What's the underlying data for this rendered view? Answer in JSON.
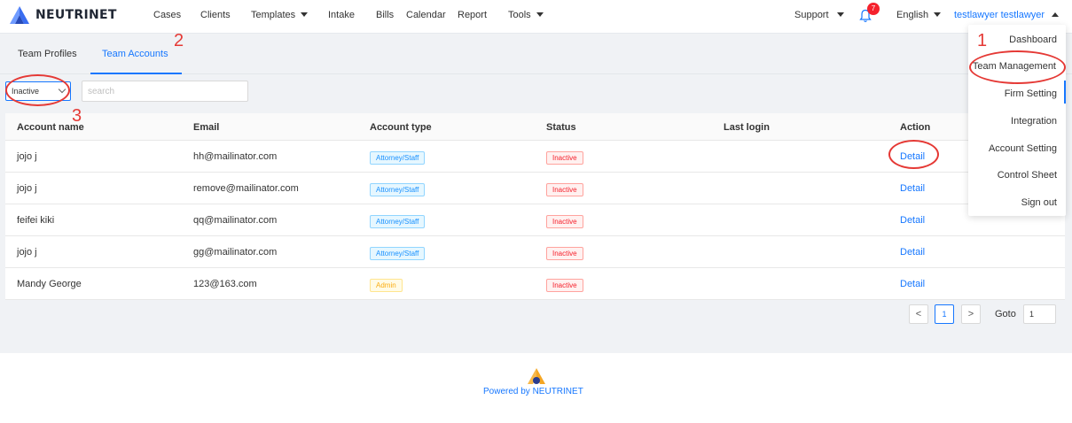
{
  "nav": {
    "brand": "NEUTRINET",
    "items": [
      "Cases",
      "Clients",
      "Templates",
      "Intake",
      "Bills",
      "Calendar",
      "Report",
      "Tools"
    ],
    "support": "Support",
    "notification_count": "7",
    "language": "English",
    "user": "testlawyer testlawyer"
  },
  "tabs": [
    "Team Profiles",
    "Team Accounts"
  ],
  "active_tab": "Team Accounts",
  "filter": {
    "selected": "Inactive"
  },
  "search": {
    "placeholder": "search",
    "value": ""
  },
  "table": {
    "headers": [
      "Account name",
      "Email",
      "Account type",
      "Status",
      "Last login",
      "Action"
    ],
    "rows": [
      {
        "name": "jojo j",
        "email": "hh@mailinator.com",
        "type": "Attorney/Staff",
        "status": "Inactive",
        "last_login": "",
        "action": "Detail"
      },
      {
        "name": "jojo j",
        "email": "remove@mailinator.com",
        "type": "Attorney/Staff",
        "status": "Inactive",
        "last_login": "",
        "action": "Detail"
      },
      {
        "name": "feifei kiki",
        "email": "qq@mailinator.com",
        "type": "Attorney/Staff",
        "status": "Inactive",
        "last_login": "",
        "action": "Detail"
      },
      {
        "name": "jojo j",
        "email": "gg@mailinator.com",
        "type": "Attorney/Staff",
        "status": "Inactive",
        "last_login": "",
        "action": "Detail"
      },
      {
        "name": "Mandy George",
        "email": "123@163.com",
        "type": "Admin",
        "status": "Inactive",
        "last_login": "",
        "action": "Detail"
      }
    ]
  },
  "pagination": {
    "prev": "<",
    "current": "1",
    "next": ">",
    "goto_label": "Goto",
    "goto_value": "1"
  },
  "user_menu": [
    "Dashboard",
    "Team Management",
    "Firm Setting",
    "Integration",
    "Account Setting",
    "Control Sheet",
    "Sign out"
  ],
  "annotations": [
    "1",
    "2",
    "3"
  ],
  "footer": {
    "powered_by": "Powered by NEUTRINET"
  },
  "colors": {
    "accent": "#1677ff",
    "annotation": "#e53935",
    "logo_blue": "#3a6df0",
    "logo_orange": "#f5a623"
  }
}
